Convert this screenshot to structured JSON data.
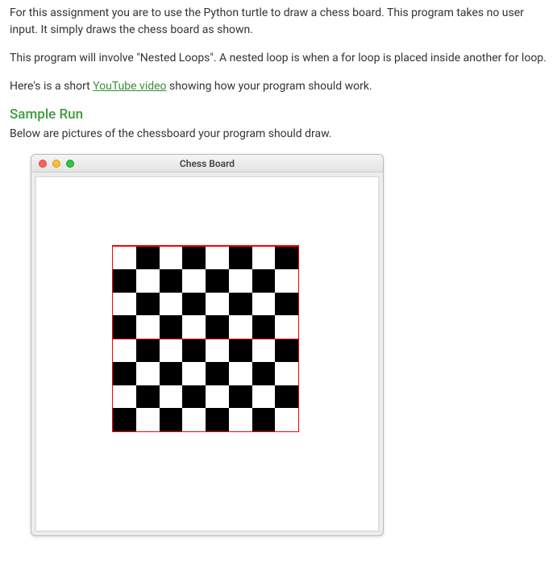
{
  "paragraphs": {
    "p1": "For this assignment you are to use the Python turtle to draw a chess board. This program takes no user input. It simply draws the chess board as shown.",
    "p2a": "This program will involve \"Nested Loops\". A nested loop is when a for loop is placed inside another for loop.",
    "p3a": "Here's is a short ",
    "p3link": "YouTube video",
    "p3b": " showing how your program should work.",
    "subheading": "Below are pictures of the chessboard your program should draw."
  },
  "heading": "Sample Run",
  "window": {
    "title": "Chess Board"
  },
  "chessboard": {
    "rows": 8,
    "cols": 8,
    "border_color": "#ff0000",
    "colors": {
      "dark": "#000000",
      "light": "#ffffff"
    },
    "pattern_top_left": "light"
  }
}
